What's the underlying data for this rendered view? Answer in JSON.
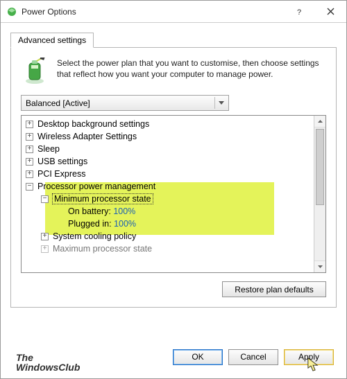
{
  "window": {
    "title": "Power Options"
  },
  "tab": {
    "label": "Advanced settings"
  },
  "intro": "Select the power plan that you want to customise, then choose settings that reflect how you want your computer to manage power.",
  "plan": {
    "selected": "Balanced [Active]"
  },
  "tree": {
    "items": [
      {
        "label": "Desktop background settings"
      },
      {
        "label": "Wireless Adapter Settings"
      },
      {
        "label": "Sleep"
      },
      {
        "label": "USB settings"
      },
      {
        "label": "PCI Express"
      }
    ],
    "ppm": {
      "label": "Processor power management",
      "min_state": {
        "label": "Minimum processor state",
        "on_battery_label": "On battery:",
        "on_battery_value": "100%",
        "plugged_in_label": "Plugged in:",
        "plugged_in_value": "100%"
      },
      "cooling": {
        "label": "System cooling policy"
      },
      "max_state": {
        "label": "Maximum processor state"
      }
    }
  },
  "buttons": {
    "restore": "Restore plan defaults",
    "ok": "OK",
    "cancel": "Cancel",
    "apply": "Apply"
  },
  "brand": {
    "line1": "The",
    "line2": "WindowsClub"
  }
}
